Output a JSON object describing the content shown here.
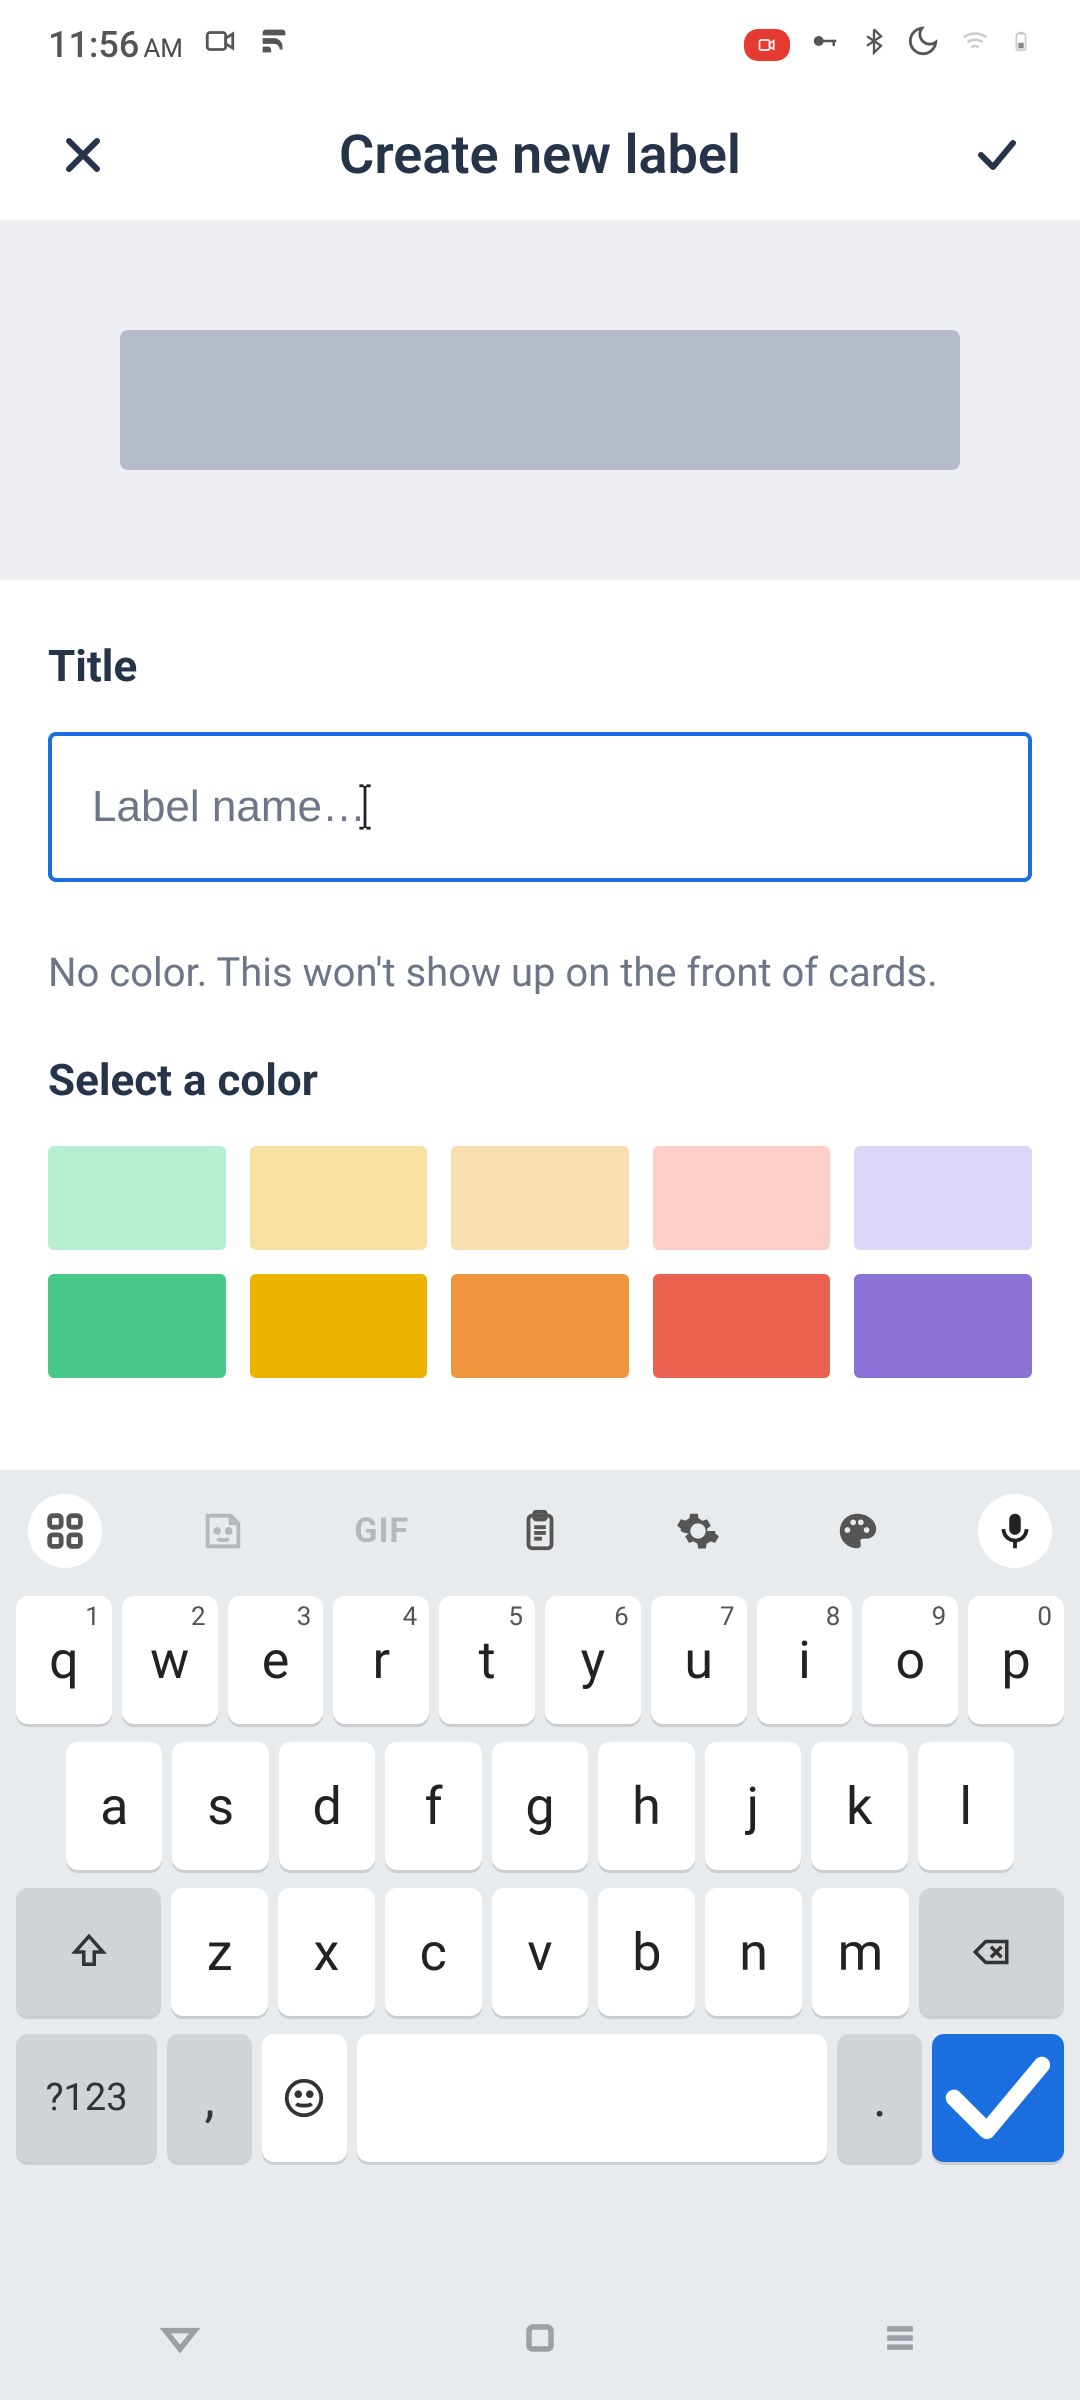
{
  "status": {
    "time": "11:56",
    "ampm": "AM"
  },
  "header": {
    "title": "Create new label"
  },
  "form": {
    "title_label": "Title",
    "title_placeholder": "Label name…",
    "title_value": "",
    "helper_text": "No color. This won't show up on the front of cards.",
    "color_label": "Select a color"
  },
  "colors": {
    "row1": [
      "#b6eed3",
      "#f6e1a0",
      "#f9deb0",
      "#fbcfc7",
      "#dbd5f7"
    ],
    "row2": [
      "#47c788",
      "#ecb400",
      "#f0953e",
      "#ea6150",
      "#8b72d7"
    ]
  },
  "keyboard": {
    "toolbar_gif": "GIF",
    "row1": [
      {
        "main": "q",
        "sup": "1"
      },
      {
        "main": "w",
        "sup": "2"
      },
      {
        "main": "e",
        "sup": "3"
      },
      {
        "main": "r",
        "sup": "4"
      },
      {
        "main": "t",
        "sup": "5"
      },
      {
        "main": "y",
        "sup": "6"
      },
      {
        "main": "u",
        "sup": "7"
      },
      {
        "main": "i",
        "sup": "8"
      },
      {
        "main": "o",
        "sup": "9"
      },
      {
        "main": "p",
        "sup": "0"
      }
    ],
    "row2": [
      "a",
      "s",
      "d",
      "f",
      "g",
      "h",
      "j",
      "k",
      "l"
    ],
    "row3": [
      "z",
      "x",
      "c",
      "v",
      "b",
      "n",
      "m"
    ],
    "symbols_key": "?123",
    "comma": ",",
    "period": "."
  }
}
